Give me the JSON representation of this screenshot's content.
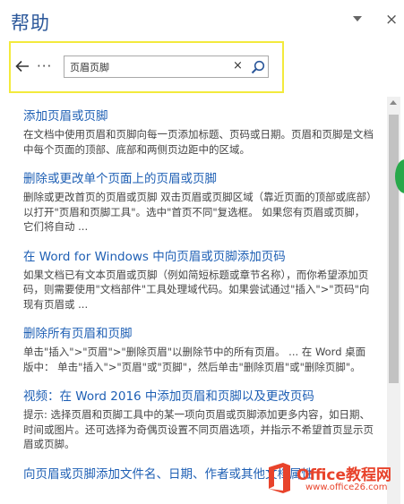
{
  "pane": {
    "title": "帮助",
    "close_glyph": "×"
  },
  "toolbar": {
    "back_glyph": "←",
    "more_glyph": "···"
  },
  "search": {
    "value": "页眉页脚",
    "clear_glyph": "×"
  },
  "results": [
    {
      "title": "添加页眉或页脚",
      "snippet": "在文档中使用页眉和页脚向每一页添加标题、页码或日期。页眉和页脚是文档中每个页面的顶部、底部和两侧页边距中的区域。"
    },
    {
      "title": "删除或更改单个页面上的页眉或页脚",
      "snippet": "删除或更改首页的页眉或页脚 双击页眉或页脚区域（靠近页面的顶部或底部）以打开\"页眉和页脚工具\"。选中\"首页不同\"复选框。 如果您有页眉或页脚，它们将自动 ..."
    },
    {
      "title": "在 Word for Windows 中向页眉或页脚添加页码",
      "snippet": "如果文档已有文本页眉或页脚（例如简短标题或章节名称），而你希望添加页码，则需要使用\"文档部件\"工具处理域代码。如果尝试通过\"插入\">\"页码\"向现有页眉或 ..."
    },
    {
      "title": "删除所有页眉和页脚",
      "snippet": "单击\"插入\">\"页眉\">\"删除页眉\"以删除节中的所有页眉。 ... 在 Word 桌面版中： 单击\"插入\">\"页眉\"或\"页脚\"，然后单击\"删除页眉\"或\"删除页脚\"。"
    },
    {
      "title": "视频：在 Word 2016 中添加页眉和页脚以及更改页码",
      "snippet": "提示: 选择页眉和页脚工具中的某一项向页眉或页脚添加更多内容，如日期、时间或图片。还可选择为奇偶页设置不同页眉选项，并指示不希望首页显示页眉或页脚。"
    },
    {
      "title": "向页眉或页脚添加文件名、日期、作者或其他文档属性",
      "snippet": ""
    }
  ],
  "watermark": {
    "main": "Office教程网",
    "url": "www.office26.com"
  },
  "colors": {
    "title": "#2b579a",
    "link": "#1e5fb4",
    "highlight_border": "#f3ea3c",
    "watermark": "#e8432b"
  },
  "icons": {
    "back": "arrow-left-icon",
    "more": "ellipsis-icon",
    "clear": "close-icon",
    "search": "magnifier-icon",
    "pane_menu": "chevron-down-icon",
    "pane_close": "close-icon"
  }
}
